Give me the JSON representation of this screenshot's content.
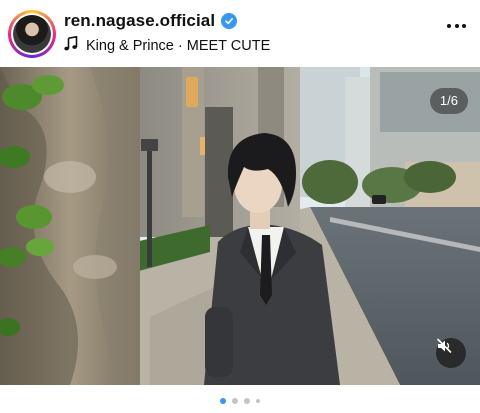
{
  "post": {
    "username": "ren.nagase.official",
    "music": "King & Prince · MEET CUTE",
    "verified": true,
    "media_counter": "1/6",
    "current_slide": 1,
    "total_slides": 6
  },
  "icons": {
    "verified": "verified-badge-icon",
    "music": "music-note-icon",
    "more": "more-options-icon",
    "mute": "sound-off-icon"
  },
  "colors": {
    "accent_blue": "#3897f0",
    "dot_inactive": "#c4c4c4"
  }
}
